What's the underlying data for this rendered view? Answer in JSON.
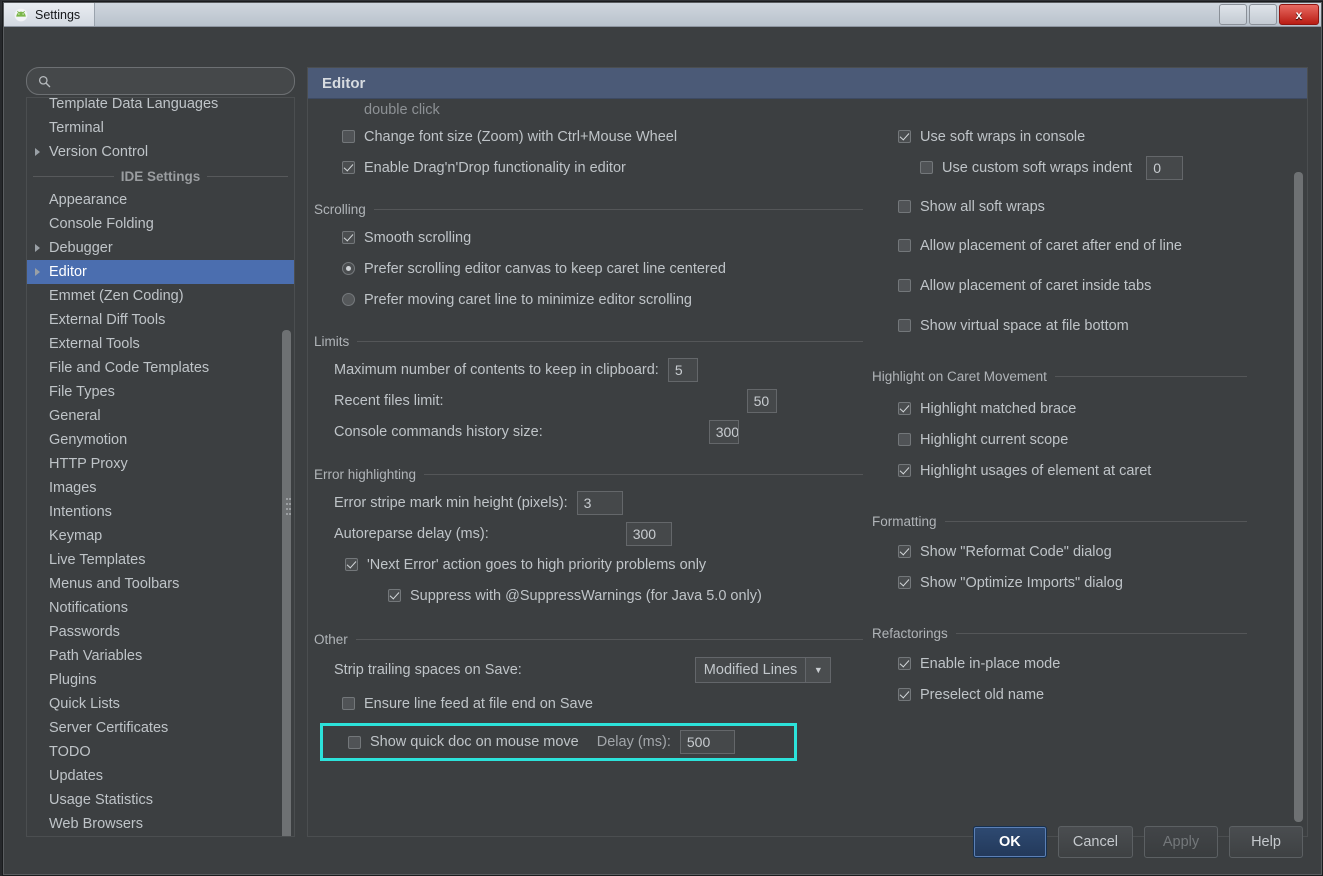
{
  "window": {
    "title": "Settings",
    "app_icon": "android-studio-icon",
    "minimize_label": "",
    "maximize_label": "",
    "close_label": "x"
  },
  "search": {
    "placeholder": "",
    "value": "",
    "icon": "search-icon"
  },
  "sidebar": {
    "items": [
      {
        "label": "Template Data Languages",
        "expandable": false,
        "selected": false,
        "clipped": true
      },
      {
        "label": "Terminal",
        "expandable": false,
        "selected": false
      },
      {
        "label": "Version Control",
        "expandable": true,
        "selected": false
      },
      {
        "separator": "IDE Settings"
      },
      {
        "label": "Appearance",
        "expandable": false,
        "selected": false
      },
      {
        "label": "Console Folding",
        "expandable": false,
        "selected": false
      },
      {
        "label": "Debugger",
        "expandable": true,
        "selected": false
      },
      {
        "label": "Editor",
        "expandable": true,
        "selected": true
      },
      {
        "label": "Emmet (Zen Coding)",
        "expandable": false,
        "selected": false
      },
      {
        "label": "External Diff Tools",
        "expandable": false,
        "selected": false
      },
      {
        "label": "External Tools",
        "expandable": false,
        "selected": false
      },
      {
        "label": "File and Code Templates",
        "expandable": false,
        "selected": false
      },
      {
        "label": "File Types",
        "expandable": false,
        "selected": false
      },
      {
        "label": "General",
        "expandable": false,
        "selected": false
      },
      {
        "label": "Genymotion",
        "expandable": false,
        "selected": false
      },
      {
        "label": "HTTP Proxy",
        "expandable": false,
        "selected": false
      },
      {
        "label": "Images",
        "expandable": false,
        "selected": false
      },
      {
        "label": "Intentions",
        "expandable": false,
        "selected": false
      },
      {
        "label": "Keymap",
        "expandable": false,
        "selected": false
      },
      {
        "label": "Live Templates",
        "expandable": false,
        "selected": false
      },
      {
        "label": "Menus and Toolbars",
        "expandable": false,
        "selected": false
      },
      {
        "label": "Notifications",
        "expandable": false,
        "selected": false
      },
      {
        "label": "Passwords",
        "expandable": false,
        "selected": false
      },
      {
        "label": "Path Variables",
        "expandable": false,
        "selected": false
      },
      {
        "label": "Plugins",
        "expandable": false,
        "selected": false
      },
      {
        "label": "Quick Lists",
        "expandable": false,
        "selected": false
      },
      {
        "label": "Server Certificates",
        "expandable": false,
        "selected": false
      },
      {
        "label": "TODO",
        "expandable": false,
        "selected": false
      },
      {
        "label": "Updates",
        "expandable": false,
        "selected": false
      },
      {
        "label": "Usage Statistics",
        "expandable": false,
        "selected": false
      },
      {
        "label": "Web Browsers",
        "expandable": false,
        "selected": false
      }
    ]
  },
  "panel": {
    "title": "Editor",
    "left": {
      "clipped_top_text": "double click",
      "change_font_size": {
        "label": "Change font size (Zoom) with Ctrl+Mouse Wheel",
        "checked": false
      },
      "dragndrop": {
        "label": "Enable Drag'n'Drop functionality in editor",
        "checked": true
      },
      "scrolling": {
        "title": "Scrolling",
        "smooth_scrolling": {
          "label": "Smooth scrolling",
          "checked": true
        },
        "radio_canvas": {
          "label": "Prefer scrolling editor canvas to keep caret line centered",
          "selected": true
        },
        "radio_caret": {
          "label": "Prefer moving caret line to minimize editor scrolling",
          "selected": false
        }
      },
      "limits": {
        "title": "Limits",
        "clipboard": {
          "label": "Maximum number of contents to keep in clipboard:",
          "value": "5"
        },
        "recent_files": {
          "label": "Recent files limit:",
          "value": "50"
        },
        "console_history": {
          "label": "Console commands history size:",
          "value": "300"
        }
      },
      "error_highlighting": {
        "title": "Error highlighting",
        "stripe_height": {
          "label": "Error stripe mark min height (pixels):",
          "value": "3"
        },
        "autoreparse": {
          "label": "Autoreparse delay (ms):",
          "value": "300"
        },
        "next_error": {
          "label": "'Next Error' action goes to high priority problems only",
          "checked": true
        },
        "suppress": {
          "label": "Suppress with @SuppressWarnings (for Java 5.0 only)",
          "checked": true
        }
      },
      "other": {
        "title": "Other",
        "strip_trailing": {
          "label": "Strip trailing spaces on Save:",
          "value": "Modified Lines"
        },
        "ensure_line_feed": {
          "label": "Ensure line feed at file end on Save",
          "checked": false
        },
        "quick_doc": {
          "label": "Show quick doc on mouse move",
          "checked": false
        },
        "quick_doc_delay_label": "Delay (ms):",
        "quick_doc_delay_value": "500",
        "highlight_color": "#2ce2da"
      }
    },
    "right": {
      "soft_wraps_console": {
        "label": "Use soft wraps in console",
        "checked": true
      },
      "custom_indent": {
        "label": "Use custom soft wraps indent",
        "checked": false,
        "value": "0"
      },
      "show_all_soft_wraps": {
        "label": "Show all soft wraps",
        "checked": false
      },
      "caret_after_eol": {
        "label": "Allow placement of caret after end of line",
        "checked": false
      },
      "caret_inside_tabs": {
        "label": "Allow placement of caret inside tabs",
        "checked": false
      },
      "virtual_space": {
        "label": "Show virtual space at file bottom",
        "checked": false
      },
      "caret_movement": {
        "title": "Highlight on Caret Movement",
        "matched_brace": {
          "label": "Highlight matched brace",
          "checked": true
        },
        "current_scope": {
          "label": "Highlight current scope",
          "checked": false
        },
        "usages": {
          "label": "Highlight usages of element at caret",
          "checked": true
        }
      },
      "formatting": {
        "title": "Formatting",
        "reformat_dialog": {
          "label": "Show \"Reformat Code\" dialog",
          "checked": true
        },
        "optimize_dialog": {
          "label": "Show \"Optimize Imports\" dialog",
          "checked": true
        }
      },
      "refactorings": {
        "title": "Refactorings",
        "in_place": {
          "label": "Enable in-place mode",
          "checked": true
        },
        "preselect": {
          "label": "Preselect old name",
          "checked": true
        }
      }
    }
  },
  "footer": {
    "ok": "OK",
    "cancel": "Cancel",
    "apply": "Apply",
    "help": "Help"
  },
  "taskbar_icon_colors": [
    "#7b7d80",
    "#8a8c8f",
    "#4f7fb5",
    "#6b6d70",
    "#4f9a4a",
    "#c9b33a",
    "#b0b2b5",
    "#9aa0a6",
    "#3f9a46",
    "#3f9a46",
    "#b5702d",
    "#c05a3a",
    "#5a7fa8",
    "#4d8fb0",
    "#b06aa8",
    "#b59a2d",
    "#c9b33a",
    "#5a6fa8",
    "#b8335a"
  ]
}
